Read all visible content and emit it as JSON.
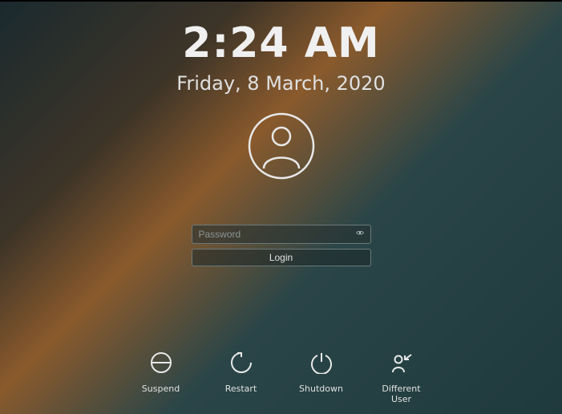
{
  "clock": {
    "time": "2:24 AM",
    "date": "Friday, 8 March, 2020"
  },
  "login": {
    "password_placeholder": "Password",
    "login_label": "Login"
  },
  "actions": {
    "suspend": "Suspend",
    "restart": "Restart",
    "shutdown": "Shutdown",
    "different_user": "Different User"
  }
}
